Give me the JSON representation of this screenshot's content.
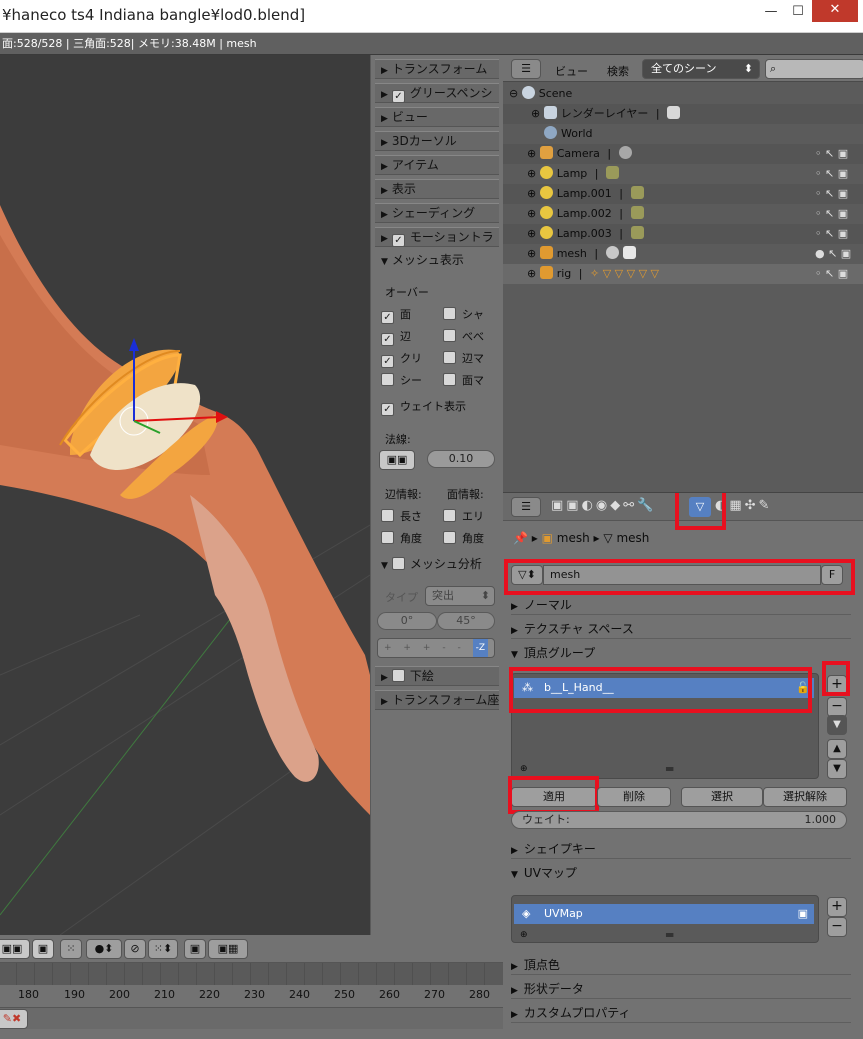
{
  "window": {
    "title": "¥haneco ts4 Indiana bangle¥lod0.blend]",
    "minimize": "—",
    "maximize": "☐",
    "close": "✕"
  },
  "infobar": {
    "text": "面:528/528 | 三角面:528| メモリ:38.48M | mesh"
  },
  "npanel": {
    "sections": [
      {
        "label": "トランスフォーム",
        "collapsed": true,
        "check": false
      },
      {
        "label": "グリースペンシ",
        "collapsed": true,
        "check": true
      },
      {
        "label": "ビュー",
        "collapsed": true,
        "check": false
      },
      {
        "label": "3Dカーソル",
        "collapsed": true,
        "check": false
      },
      {
        "label": "アイテム",
        "collapsed": true,
        "check": false
      },
      {
        "label": "表示",
        "collapsed": true,
        "check": false
      },
      {
        "label": "シェーディング",
        "collapsed": true,
        "check": false
      },
      {
        "label": "モーショントラ",
        "collapsed": true,
        "check": true
      }
    ],
    "mesh_display": {
      "label": "メッシュ表示",
      "overlay_label": "オーバー",
      "checks_left": [
        {
          "label": "面",
          "checked": true
        },
        {
          "label": "辺",
          "checked": true
        },
        {
          "label": "クリ",
          "checked": true
        },
        {
          "label": "シー",
          "checked": false
        }
      ],
      "checks_right": [
        {
          "label": "シャ",
          "checked": false
        },
        {
          "label": "べべ",
          "checked": false
        },
        {
          "label": "辺マ",
          "checked": false
        },
        {
          "label": "面マ",
          "checked": false
        }
      ],
      "weight": {
        "label": "ウェイト表示",
        "checked": true
      },
      "normals_label": "法線:",
      "normal_size": "0.10",
      "edge_info_label": "辺情報:",
      "face_info_label": "面情報:",
      "edge_checks": [
        {
          "label": "長さ",
          "checked": false
        },
        {
          "label": "角度",
          "checked": false
        }
      ],
      "face_checks": [
        {
          "label": "エリ",
          "checked": false
        },
        {
          "label": "角度",
          "checked": false
        }
      ]
    },
    "mesh_analysis": {
      "label": "メッシュ分析",
      "type_label": "タイプ",
      "type_value": "突出",
      "min": "0°",
      "max": "45°",
      "axis_buttons": [
        "+",
        "+",
        "+",
        "-",
        "-",
        "-Z"
      ]
    },
    "background": {
      "label": "下絵"
    },
    "transform_orient": {
      "label": "トランスフォーム座"
    }
  },
  "outliner": {
    "view_label": "ビュー",
    "search_label": "検索",
    "scene_select": "全てのシーン",
    "rows": [
      {
        "label": "Scene",
        "indent": 0,
        "icon": "#c9d4e0"
      },
      {
        "label": "レンダーレイヤー",
        "indent": 1,
        "icon": "#c9d4e0"
      },
      {
        "label": "World",
        "indent": 1,
        "icon": "#8fa8c4"
      },
      {
        "label": "Camera",
        "indent": 1,
        "icon": "#e0a040"
      },
      {
        "label": "Lamp",
        "indent": 1,
        "icon": "#e8c640"
      },
      {
        "label": "Lamp.001",
        "indent": 1,
        "icon": "#e8c640"
      },
      {
        "label": "Lamp.002",
        "indent": 1,
        "icon": "#e8c640"
      },
      {
        "label": "Lamp.003",
        "indent": 1,
        "icon": "#e8c640"
      },
      {
        "label": "mesh",
        "indent": 1,
        "icon": "#e09a30"
      },
      {
        "label": "rig",
        "indent": 1,
        "icon": "#e09a30"
      }
    ]
  },
  "properties": {
    "breadcrumb": [
      "mesh",
      "mesh"
    ],
    "datablock": "mesh",
    "fake_user": "F",
    "sections": {
      "normals": "ノーマル",
      "texspace": "テクスチャ スペース",
      "vgroups": "頂点グループ",
      "shapekeys": "シェイプキー",
      "uvmaps": "UVマップ",
      "vcolors": "頂点色",
      "geometry": "形状データ",
      "custom": "カスタムプロパティ"
    },
    "vertex_group": "b__L_Hand__",
    "buttons": {
      "assign": "適用",
      "remove": "削除",
      "select": "選択",
      "deselect": "選択解除"
    },
    "weight_label": "ウェイト:",
    "weight_value": "1.000",
    "uvmap": "UVMap"
  },
  "timeline": {
    "ticks": [
      "180",
      "190",
      "200",
      "210",
      "220",
      "230",
      "240",
      "250",
      "260",
      "270",
      "280"
    ]
  },
  "colors": {
    "highlight": "#e8101f",
    "selection": "#5680c2"
  }
}
